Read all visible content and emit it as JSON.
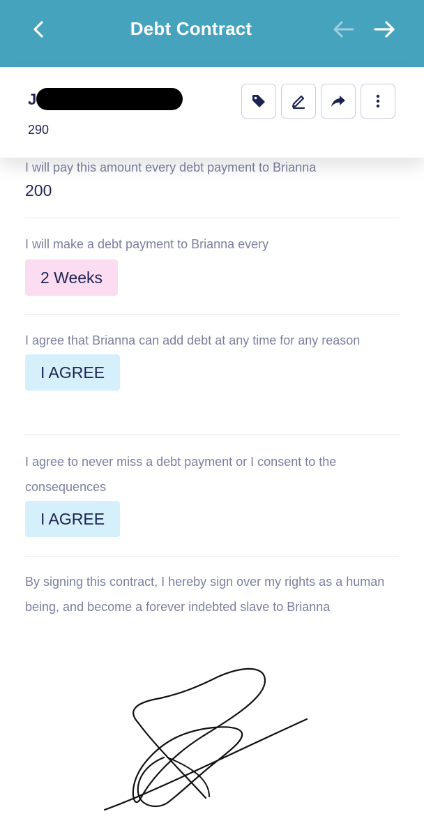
{
  "topbar": {
    "title": "Debt Contract",
    "bg_color": "#45a3bd",
    "back_icon": "chevron-left-icon",
    "prev_icon": "arrow-left-icon",
    "next_icon": "arrow-right-icon"
  },
  "header": {
    "name_initial": "J",
    "amount": "290",
    "actions": [
      "tag-icon",
      "edit-icon",
      "share-icon",
      "more-vertical-icon"
    ]
  },
  "terms": {
    "payment_amount": {
      "label": "I will pay this amount every debt payment to Brianna",
      "value": "200"
    },
    "payment_frequency": {
      "label": "I will make a debt payment to Brianna every",
      "value": "2 Weeks"
    },
    "add_debt": {
      "label": "I agree that Brianna can add debt at any time for any reason",
      "value": "I AGREE"
    },
    "never_miss": {
      "label": "I agree to never miss a debt payment or I consent to the consequences",
      "value": "I AGREE"
    },
    "statement": "By signing this contract, I hereby sign over my rights as a human being, and become a forever indebted slave to Brianna"
  },
  "colors": {
    "pill_pink": "#fbdcf1",
    "pill_blue": "#d5f0fb",
    "label_gray": "#7b7f9e",
    "text_dark": "#1c2350"
  }
}
